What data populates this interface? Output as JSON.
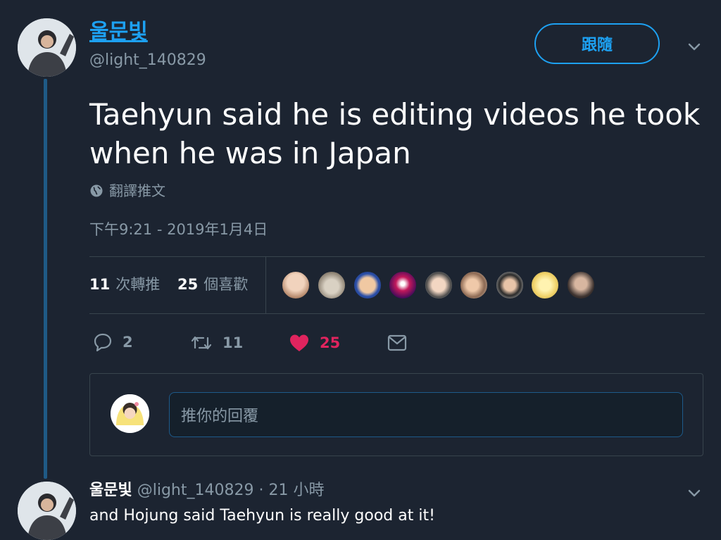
{
  "tweet": {
    "author_name": "울문빛",
    "author_handle": "@light_140829",
    "follow_label": "跟隨",
    "text": "Taehyun said he is editing videos he took when he was in Japan",
    "translate_label": "翻譯推文",
    "timestamp": "下午9:21 - 2019年1月4日"
  },
  "stats": {
    "retweets_count": "11",
    "retweets_label": "次轉推",
    "likes_count": "25",
    "likes_label": "個喜歡",
    "liker_avatars": 9
  },
  "actions": {
    "reply_count": "2",
    "retweet_count": "11",
    "like_count": "25"
  },
  "reply_compose": {
    "placeholder": "推你的回覆"
  },
  "reply": {
    "author_name": "울문빛",
    "meta": "@light_140829 · 21 小時",
    "text": "and Hojung said Taehyun is really good at it!"
  },
  "colors": {
    "background": "#1c2431",
    "accent": "#1da1f2",
    "like": "#e0245e",
    "muted": "#8899a6"
  }
}
